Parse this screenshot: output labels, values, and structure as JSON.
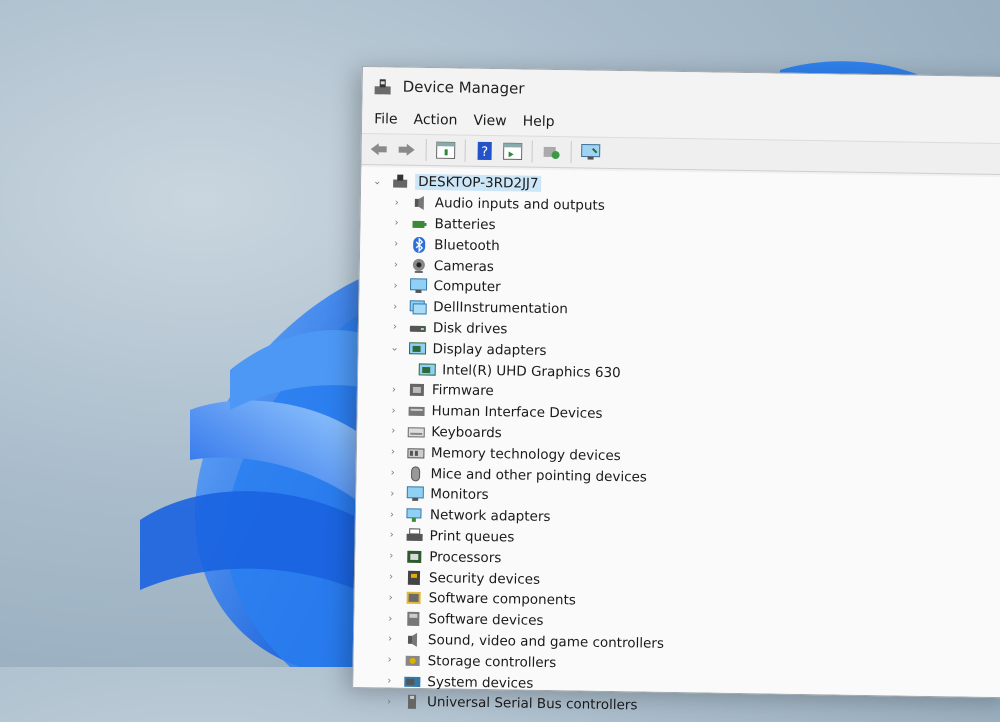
{
  "window": {
    "title": "Device Manager"
  },
  "menu": {
    "file": "File",
    "action": "Action",
    "view": "View",
    "help": "Help"
  },
  "toolbar": {
    "icons": [
      "back-arrow-icon",
      "forward-arrow-icon",
      "properties-icon",
      "help-icon",
      "update-driver-icon",
      "scan-hardware-icon",
      "monitor-icon"
    ]
  },
  "tree": {
    "root": "DESKTOP-3RD2JJ7",
    "items": [
      {
        "label": "Audio inputs and outputs",
        "expanded": false
      },
      {
        "label": "Batteries",
        "expanded": false
      },
      {
        "label": "Bluetooth",
        "expanded": false
      },
      {
        "label": "Cameras",
        "expanded": false
      },
      {
        "label": "Computer",
        "expanded": false
      },
      {
        "label": "DellInstrumentation",
        "expanded": false
      },
      {
        "label": "Disk drives",
        "expanded": false
      },
      {
        "label": "Display adapters",
        "expanded": true
      },
      {
        "label": "Intel(R) UHD Graphics 630",
        "child": true
      },
      {
        "label": "Firmware",
        "expanded": false
      },
      {
        "label": "Human Interface Devices",
        "expanded": false
      },
      {
        "label": "Keyboards",
        "expanded": false
      },
      {
        "label": "Memory technology devices",
        "expanded": false
      },
      {
        "label": "Mice and other pointing devices",
        "expanded": false
      },
      {
        "label": "Monitors",
        "expanded": false
      },
      {
        "label": "Network adapters",
        "expanded": false
      },
      {
        "label": "Print queues",
        "expanded": false
      },
      {
        "label": "Processors",
        "expanded": false
      },
      {
        "label": "Security devices",
        "expanded": false
      },
      {
        "label": "Software components",
        "expanded": false
      },
      {
        "label": "Software devices",
        "expanded": false
      },
      {
        "label": "Sound, video and game controllers",
        "expanded": false
      },
      {
        "label": "Storage controllers",
        "expanded": false
      },
      {
        "label": "System devices",
        "expanded": false
      },
      {
        "label": "Universal Serial Bus controllers",
        "expanded": false
      }
    ]
  },
  "colors": {
    "selection": "#cde6f7",
    "wallpaper_accent": "#1f6fe0"
  }
}
